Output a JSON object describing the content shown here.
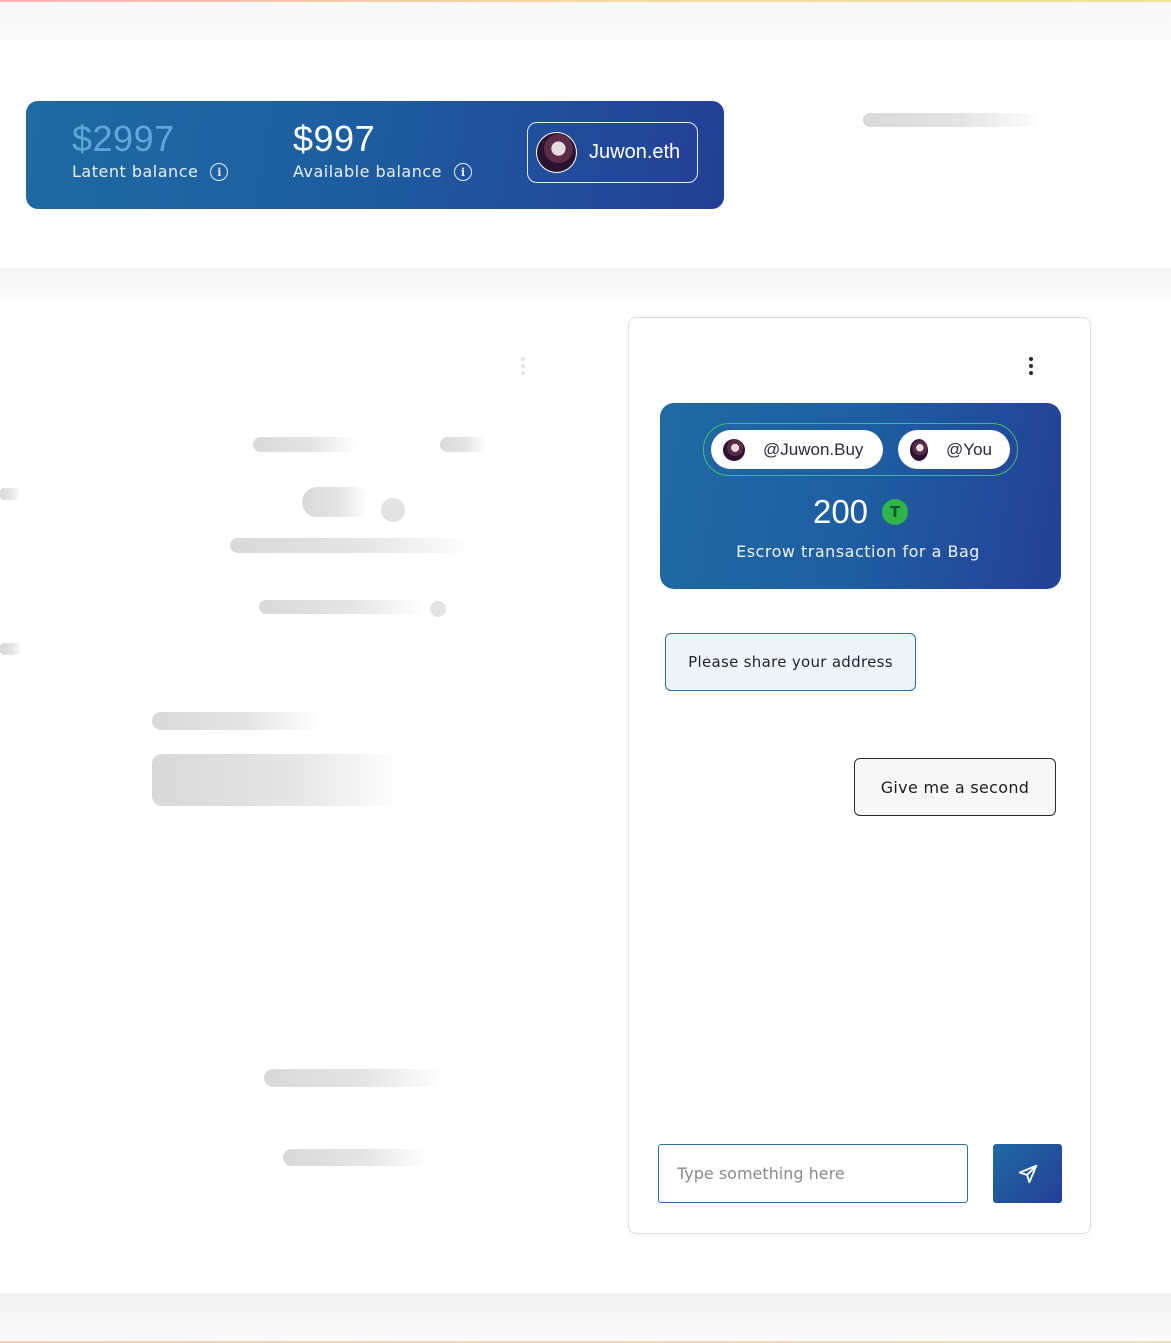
{
  "balances": {
    "latent": {
      "amount": "$2997",
      "label": "Latent balance"
    },
    "available": {
      "amount": "$997",
      "label": "Available balance"
    }
  },
  "profile": {
    "name": "Juwon.eth"
  },
  "chat": {
    "escrow": {
      "parties": [
        "@Juwon.Buy",
        "@You"
      ],
      "amount": "200",
      "token_glyph": "T",
      "description": "Escrow transaction for a Bag"
    },
    "messages": [
      {
        "side": "received",
        "text": "Please share your address"
      },
      {
        "side": "sent",
        "text": "Give me a second"
      }
    ],
    "input": {
      "placeholder": "Type something here",
      "value": ""
    }
  },
  "icons": {
    "info": "info-icon",
    "more": "kebab-menu-icon",
    "send": "send-icon",
    "token": "tether-token-icon"
  },
  "colors": {
    "brand_blue": "#1e5ea1",
    "brand_indigo": "#243f96",
    "token_green": "#2fb34a",
    "parties_outline": "#3fbf6e"
  }
}
